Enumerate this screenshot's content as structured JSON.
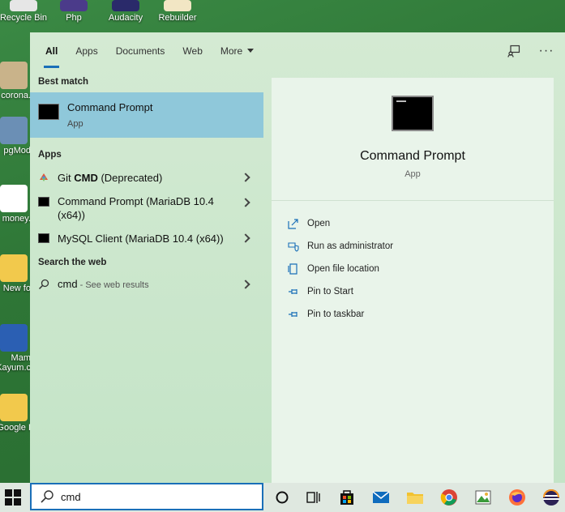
{
  "desktop": {
    "top_icons": [
      {
        "label": "Recycle Bin"
      },
      {
        "label": "Php"
      },
      {
        "label": "Audacity"
      },
      {
        "label": "Rebuilder"
      }
    ],
    "left_icons": [
      {
        "label": "corona."
      },
      {
        "label": "pgMod"
      },
      {
        "label": "money."
      },
      {
        "label": "New fo"
      },
      {
        "label": "Mam Kayum.c"
      },
      {
        "label": "Google I"
      }
    ]
  },
  "start_menu": {
    "tabs": [
      {
        "label": "All"
      },
      {
        "label": "Apps"
      },
      {
        "label": "Documents"
      },
      {
        "label": "Web"
      },
      {
        "label": "More"
      }
    ],
    "sections": {
      "best_match": "Best match",
      "apps": "Apps",
      "web": "Search the web"
    },
    "best_match": {
      "title": "Command Prompt",
      "subtitle": "App"
    },
    "apps": [
      {
        "prefix": "Git ",
        "bold": "CMD",
        "suffix": " (Deprecated)"
      },
      {
        "label": "Command Prompt (MariaDB 10.4 (x64))"
      },
      {
        "label": "MySQL Client (MariaDB 10.4 (x64))"
      }
    ],
    "web": {
      "query": "cmd",
      "hint": " - See web results"
    },
    "detail": {
      "title": "Command Prompt",
      "subtitle": "App",
      "actions": [
        {
          "label": "Open",
          "icon": "open-icon"
        },
        {
          "label": "Run as administrator",
          "icon": "shield-icon"
        },
        {
          "label": "Open file location",
          "icon": "file-location-icon"
        },
        {
          "label": "Pin to Start",
          "icon": "pin-icon"
        },
        {
          "label": "Pin to taskbar",
          "icon": "pin-icon"
        }
      ]
    }
  },
  "taskbar": {
    "search_value": "cmd"
  },
  "colors": {
    "accent": "#1a6fb8",
    "selected_row": "#8fc8da",
    "menu_bg": "#cde8cf"
  }
}
